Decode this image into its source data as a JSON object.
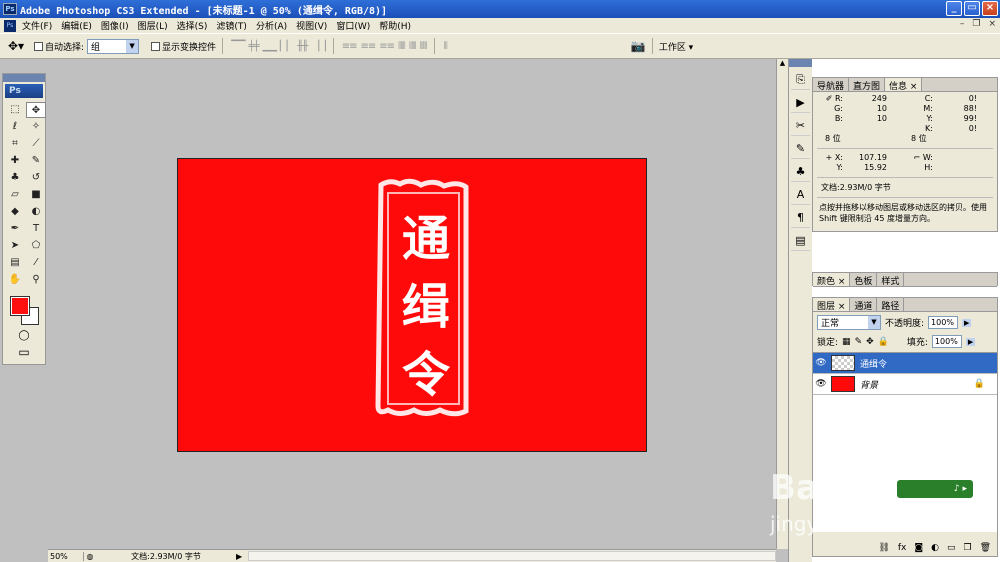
{
  "window": {
    "title": "Adobe Photoshop CS3 Extended - [未标题-1 @ 50% (通缉令, RGB/8)]",
    "app_icon": "Ps"
  },
  "menubar": {
    "items": [
      "文件(F)",
      "编辑(E)",
      "图像(I)",
      "图层(L)",
      "选择(S)",
      "滤镜(T)",
      "分析(A)",
      "视图(V)",
      "窗口(W)",
      "帮助(H)"
    ]
  },
  "options": {
    "auto_select_label": "自动选择:",
    "auto_select_value": "组",
    "show_transform_label": "显示变换控件",
    "workspace_label": "工作区 ▾"
  },
  "toolbox": {
    "logo": "Ps",
    "fg_color": "#ff1010",
    "bg_color": "#ffffff"
  },
  "canvas": {
    "bg_color": "#ff0a0a",
    "poster_text": [
      "通",
      "缉",
      "令"
    ]
  },
  "statusbar": {
    "zoom": "50%",
    "doc": "文档:2.93M/0 字节"
  },
  "info_panel": {
    "tabs": [
      "导航器",
      "直方图",
      "信息 ×"
    ],
    "rgb": [
      {
        "label": "R:",
        "value": "249"
      },
      {
        "label": "G:",
        "value": "10"
      },
      {
        "label": "B:",
        "value": "10"
      }
    ],
    "cmyk": [
      {
        "label": "C:",
        "value": "0!"
      },
      {
        "label": "M:",
        "value": "88!"
      },
      {
        "label": "Y:",
        "value": "99!"
      },
      {
        "label": "K:",
        "value": "0!"
      }
    ],
    "bit_left": "8 位",
    "bit_right": "8 位",
    "x_label": "X:",
    "x_value": "107.19",
    "y_label": "Y:",
    "y_value": "15.92",
    "w_label": "W:",
    "h_label": "H:",
    "doc": "文档:2.93M/0 字节",
    "hint": "点按并拖移以移动图层或移动选区的拷贝。使用 Shift 键限制沿 45 度增量方向。"
  },
  "color_panel": {
    "tabs": [
      "颜色 ×",
      "色板",
      "样式"
    ]
  },
  "layers_panel": {
    "tabs": [
      "图层 ×",
      "通道",
      "路径"
    ],
    "blend_mode": "正常",
    "opacity_label": "不透明度:",
    "opacity_value": "100%",
    "lock_label": "锁定:",
    "fill_label": "填充:",
    "fill_value": "100%",
    "layers": [
      {
        "name": "通缉令",
        "selected": true
      },
      {
        "name": "背景",
        "selected": false
      }
    ]
  },
  "watermark": {
    "brand": "Bai经验",
    "url": "jingyan.baidu.com"
  }
}
